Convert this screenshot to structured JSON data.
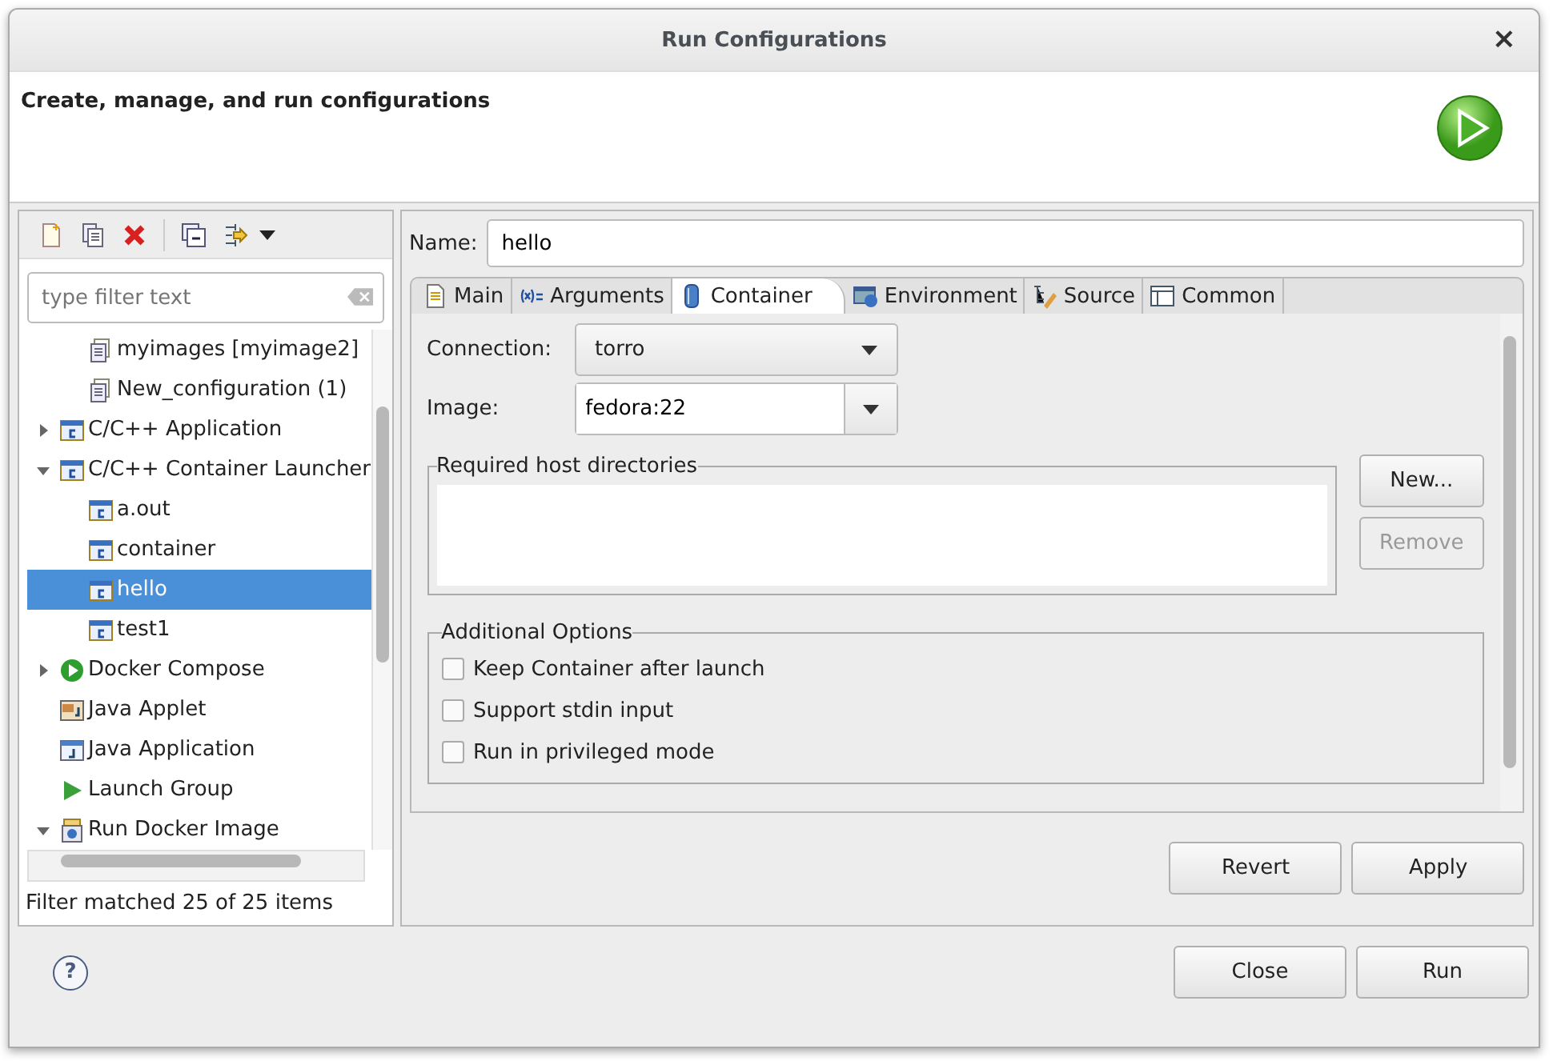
{
  "window": {
    "title": "Run Configurations",
    "close": "×"
  },
  "header": {
    "message": "Create, manage, and run configurations"
  },
  "filter": {
    "placeholder": "type filter text"
  },
  "tree": {
    "continued_children": [
      {
        "label": "myimages [myimage2]",
        "kind": "file",
        "selected": false
      },
      {
        "label": "New_configuration (1)",
        "kind": "file",
        "selected": false
      }
    ],
    "items": [
      {
        "label": "C/C++ Application",
        "kind": "c",
        "expanded": false,
        "selected": false
      },
      {
        "label": "C/C++ Container Launcher",
        "kind": "c",
        "expanded": true,
        "selected": false,
        "children": [
          {
            "label": "a.out",
            "kind": "c",
            "selected": false
          },
          {
            "label": "container",
            "kind": "c",
            "selected": false
          },
          {
            "label": "hello",
            "kind": "c",
            "selected": true
          },
          {
            "label": "test1",
            "kind": "c",
            "selected": false
          }
        ]
      },
      {
        "label": "Docker Compose",
        "kind": "compose",
        "expanded": false,
        "selected": false
      },
      {
        "label": "Java Applet",
        "kind": "applet",
        "selected": false
      },
      {
        "label": "Java Application",
        "kind": "java",
        "selected": false
      },
      {
        "label": "Launch Group",
        "kind": "group",
        "selected": false
      },
      {
        "label": "Run Docker Image",
        "kind": "docker",
        "expanded": true,
        "selected": false
      }
    ]
  },
  "filter_status": "Filter matched 25 of 25 items",
  "name_field": {
    "label": "Name:",
    "value": "hello"
  },
  "tabs": [
    {
      "label": "Main",
      "kind": "main",
      "selected": false
    },
    {
      "label": "Arguments",
      "kind": "args",
      "selected": false
    },
    {
      "label": "Container",
      "kind": "container",
      "selected": true
    },
    {
      "label": "Environment",
      "kind": "env",
      "selected": false
    },
    {
      "label": "Source",
      "kind": "source",
      "selected": false
    },
    {
      "label": "Common",
      "kind": "common",
      "selected": false
    }
  ],
  "connection": {
    "label": "Connection:",
    "value": "torro"
  },
  "image": {
    "label": "Image:",
    "value": "fedora:22"
  },
  "host_directories": {
    "title": "Required host directories",
    "buttons": [
      {
        "label": "New...",
        "disabled": false
      },
      {
        "label": "Remove",
        "disabled": true
      }
    ]
  },
  "options": {
    "title": "Additional Options",
    "items": [
      {
        "label": "Keep Container after launch",
        "checked": false
      },
      {
        "label": "Support stdin input",
        "checked": false
      },
      {
        "label": "Run in privileged mode",
        "checked": false
      }
    ]
  },
  "tab_buttons": [
    "Revert",
    "Apply"
  ],
  "dialog_buttons": [
    "Close",
    "Run"
  ],
  "help": "?"
}
